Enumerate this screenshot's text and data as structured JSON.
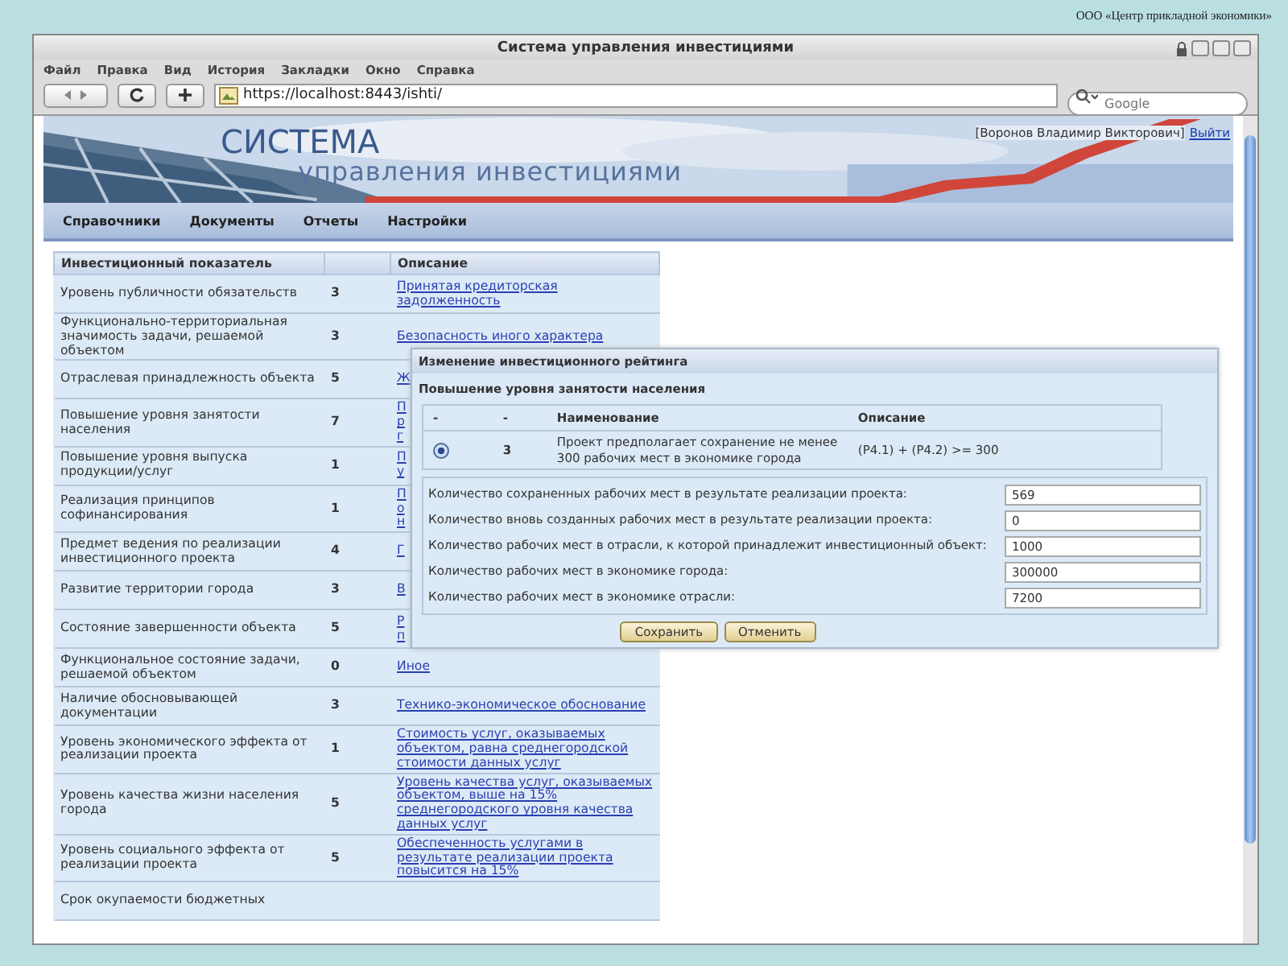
{
  "slide_caption": "ООО «Центр прикладной экономики»",
  "window": {
    "title": "Система управления инвестициями"
  },
  "menu": [
    "Файл",
    "Правка",
    "Вид",
    "История",
    "Закладки",
    "Окно",
    "Справка"
  ],
  "address_bar": {
    "value": "https://localhost:8443/ishti/"
  },
  "search": {
    "placeholder": "Google"
  },
  "banner": {
    "title": "СИСТЕМА",
    "subtitle": "управления инвестициями",
    "user": "[Воронов Владимир Викторович]",
    "logout": "Выйти"
  },
  "nav": [
    "Справочники",
    "Документы",
    "Отчеты",
    "Настройки"
  ],
  "table": {
    "columns": [
      "Инвестиционный показатель",
      "Описание"
    ],
    "rows": [
      {
        "name": "Уровень публичности обязательств",
        "score": "3",
        "description": "Принятая кредиторская задолженность"
      },
      {
        "name": "Функционально-территориальная значимость задачи, решаемой объектом",
        "score": "3",
        "description": "Безопасность иного характера"
      },
      {
        "name": "Отраслевая принадлежность объекта",
        "score": "5",
        "description": "Ж"
      },
      {
        "name": "Повышение уровня занятости населения",
        "score": "7",
        "description": "П\nр\nг"
      },
      {
        "name": "Повышение уровня выпуска продукции/услуг",
        "score": "1",
        "description": "П\nу"
      },
      {
        "name": "Реализация принципов софинансирования",
        "score": "1",
        "description": "П\nо\nн"
      },
      {
        "name": "Предмет ведения по реализации инвестиционного проекта",
        "score": "4",
        "description": "Г"
      },
      {
        "name": "Развитие территории города",
        "score": "3",
        "description": "В"
      },
      {
        "name": "Состояние завершенности объекта",
        "score": "5",
        "description": "Р\nп"
      },
      {
        "name": "Функциональное состояние задачи, решаемой объектом",
        "score": "0",
        "description": "Иное"
      },
      {
        "name": "Наличие обосновывающей документации",
        "score": "3",
        "description": "Технико-экономическое обоснование"
      },
      {
        "name": "Уровень экономического эффекта от реализации проекта",
        "score": "1",
        "description": "Стоимость услуг, оказываемых объектом, равна среднегородской стоимости данных услуг"
      },
      {
        "name": "Уровень качества жизни населения города",
        "score": "5",
        "description": "Уровень качества услуг, оказываемых объектом, выше на 15% среднегородского уровня качества данных услуг"
      },
      {
        "name": "Уровень социального эффекта от реализации проекта",
        "score": "5",
        "description": "Обеспеченность услугами в результате реализации проекта повысится на 15%"
      },
      {
        "name": "Срок окупаемости бюджетных",
        "score": "",
        "description": ""
      }
    ]
  },
  "dialog": {
    "title": "Изменение инвестиционного рейтинга",
    "subtitle": "Повышение уровня занятости населения",
    "columns": [
      "-",
      "-",
      "Наименование",
      "Описание"
    ],
    "options": [
      {
        "selected": true,
        "score": "3",
        "name": "Проект предполагает сохранение не менее 300 рабочих мест в экономике города",
        "description": "(P4.1) + (P4.2) >= 300"
      }
    ],
    "fields": [
      {
        "label": "Количество сохраненных рабочих мест в результате реализации проекта:",
        "value": "569"
      },
      {
        "label": "Количество вновь созданных рабочих мест в результате реализации проекта:",
        "value": "0"
      },
      {
        "label": "Количество рабочих мест в отрасли, к которой принадлежит инвестиционный объект:",
        "value": "1000"
      },
      {
        "label": "Количество рабочих мест в экономике города:",
        "value": "300000"
      },
      {
        "label": "Количество рабочих мест в экономике отрасли:",
        "value": "7200"
      }
    ],
    "buttons": [
      "Сохранить",
      "Отменить"
    ]
  }
}
